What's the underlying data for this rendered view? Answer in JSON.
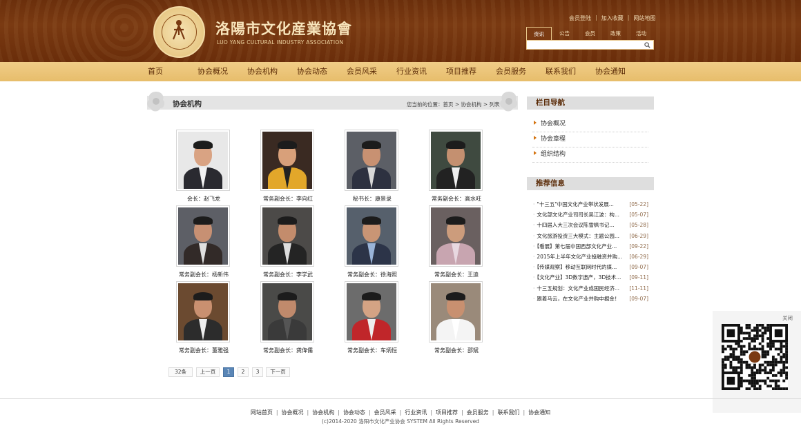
{
  "header": {
    "logo_cn": "洛陽市文化産業協會",
    "logo_en": "LUO YANG CULTURAL INDUSTRY ASSOCIATION",
    "top_links": [
      "会员登陆",
      "加入收藏",
      "网站地图"
    ],
    "search_tabs": [
      "资讯",
      "公告",
      "会员",
      "政策",
      "活动"
    ],
    "search_placeholder": ""
  },
  "nav": [
    "首页",
    "协会概况",
    "协会机构",
    "协会动态",
    "会员风采",
    "行业资讯",
    "项目推荐",
    "会员服务",
    "联系我们",
    "协会通知"
  ],
  "section": {
    "title": "协会机构",
    "breadcrumb": "您当前的位置：首页 > 协会机构 > 列表"
  },
  "members": [
    {
      "caption": "会长：赵飞龙"
    },
    {
      "caption": "常务副会长：李向红"
    },
    {
      "caption": "秘书长：康景录"
    },
    {
      "caption": "常务副会长：高水旺"
    },
    {
      "caption": "常务副会长：杨新伟"
    },
    {
      "caption": "常务副会长：李学武"
    },
    {
      "caption": "常务副会长：徐海照"
    },
    {
      "caption": "常务副会长：王迪"
    },
    {
      "caption": "常务副会长：董雅强"
    },
    {
      "caption": "常务副会长：龚偉儒"
    },
    {
      "caption": "常务副会长：车炳恒"
    },
    {
      "caption": "常务副会长：邵斌"
    }
  ],
  "pager": {
    "total": "32条",
    "prev": "上一页",
    "pages": [
      "1",
      "2",
      "3"
    ],
    "current": "1",
    "next": "下一页"
  },
  "sidebar": {
    "nav_title": "栏目导航",
    "nav_items": [
      "协会概况",
      "协会章程",
      "组织结构"
    ],
    "news_title": "推荐信息",
    "news": [
      {
        "title": "\"十三五\"中国文化产业带状发展...",
        "date": "[05-22]"
      },
      {
        "title": "文化部文化产业司司长吴江波：构...",
        "date": "[05-07]"
      },
      {
        "title": "十四届人大三次会议陈雪枫书记...",
        "date": "[05-28]"
      },
      {
        "title": "文化旅游投资三大模式：主题公园...",
        "date": "[06-29]"
      },
      {
        "title": "【看展】第七届中国西部文化产业...",
        "date": "[09-22]"
      },
      {
        "title": "2015年上半年文化产业投融资并购...",
        "date": "[06-29]"
      },
      {
        "title": "【传媒观察】移动互联网时代的媒...",
        "date": "[09-07]"
      },
      {
        "title": "【文化产业】3D数字遗产，3D技术...",
        "date": "[09-11]"
      },
      {
        "title": "十三五规划：文化产业成国民经济...",
        "date": "[11-11]"
      },
      {
        "title": "跟着马云，在文化产业并购中掘金！",
        "date": "[09-07]"
      }
    ]
  },
  "qr": {
    "close": "关闭"
  },
  "footer": {
    "links": [
      "网站首页",
      "协会概况",
      "协会机构",
      "协会动态",
      "会员风采",
      "行业资讯",
      "项目推荐",
      "会员服务",
      "联系我们",
      "协会通知"
    ],
    "copyright": "(c)2014-2020 洛阳市文化产业协会 SYSTEM All Rights Reserved"
  },
  "colors": {
    "header_brown": "#6b2f0c",
    "nav_gold": "#e7bd6b",
    "nav_text": "#5a2a06",
    "date_brown": "#8f6a4a",
    "pager_active": "#5a86b6"
  }
}
